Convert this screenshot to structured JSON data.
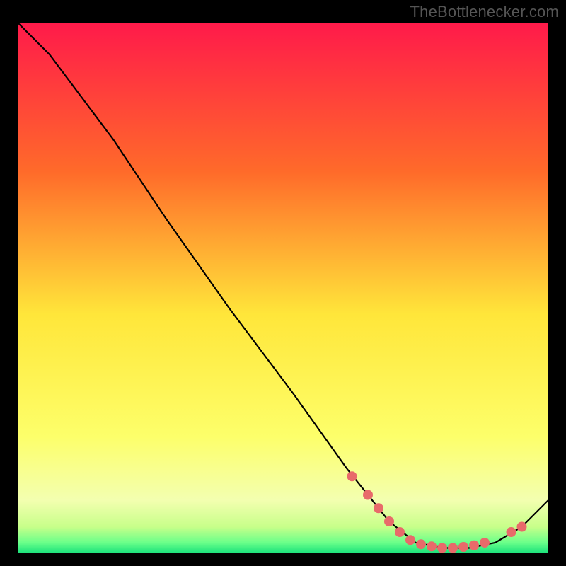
{
  "attribution": "TheBottlenecker.com",
  "chart_data": {
    "type": "line",
    "title": "",
    "xlabel": "",
    "ylabel": "",
    "xlim": [
      0,
      100
    ],
    "ylim": [
      0,
      100
    ],
    "background_gradient": {
      "top": "#ff1a4a",
      "mid_upper": "#ff8a2a",
      "mid": "#ffe63a",
      "mid_lower": "#fbff8a",
      "band": "#d9ff7a",
      "bottom": "#18e07a"
    },
    "curve": [
      {
        "x": 0,
        "y": 100
      },
      {
        "x": 6,
        "y": 94
      },
      {
        "x": 12,
        "y": 86
      },
      {
        "x": 18,
        "y": 78
      },
      {
        "x": 28,
        "y": 63
      },
      {
        "x": 40,
        "y": 46
      },
      {
        "x": 52,
        "y": 30
      },
      {
        "x": 62,
        "y": 16
      },
      {
        "x": 70,
        "y": 6
      },
      {
        "x": 75,
        "y": 2
      },
      {
        "x": 80,
        "y": 1
      },
      {
        "x": 85,
        "y": 1
      },
      {
        "x": 90,
        "y": 2
      },
      {
        "x": 95,
        "y": 5
      },
      {
        "x": 100,
        "y": 10
      }
    ],
    "markers": [
      {
        "x": 63,
        "y": 14.5
      },
      {
        "x": 66,
        "y": 11
      },
      {
        "x": 68,
        "y": 8.5
      },
      {
        "x": 70,
        "y": 6
      },
      {
        "x": 72,
        "y": 4
      },
      {
        "x": 74,
        "y": 2.5
      },
      {
        "x": 76,
        "y": 1.7
      },
      {
        "x": 78,
        "y": 1.3
      },
      {
        "x": 80,
        "y": 1
      },
      {
        "x": 82,
        "y": 1
      },
      {
        "x": 84,
        "y": 1.2
      },
      {
        "x": 86,
        "y": 1.5
      },
      {
        "x": 88,
        "y": 2
      },
      {
        "x": 93,
        "y": 4
      },
      {
        "x": 95,
        "y": 5
      }
    ],
    "marker_color": "#e86a6a",
    "curve_color": "#000000"
  }
}
